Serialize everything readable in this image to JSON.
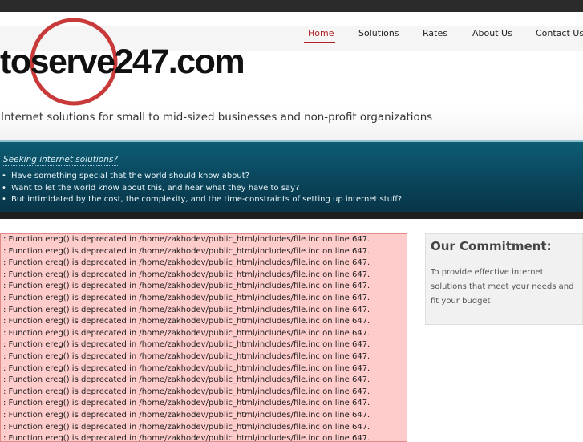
{
  "site": {
    "logo_text": "toserve247.com",
    "tagline": "Internet solutions for small to mid-sized businesses and non-profit organizations"
  },
  "nav": {
    "items": [
      {
        "label": "Home",
        "active": true
      },
      {
        "label": "Solutions",
        "active": false
      },
      {
        "label": "Rates",
        "active": false
      },
      {
        "label": "About Us",
        "active": false
      },
      {
        "label": "Contact Us",
        "active": false
      }
    ]
  },
  "banner": {
    "title": "Seeking internet solutions?",
    "items": [
      "Have something special that the world should know about?",
      "Want to let the world know about this, and hear what they have to say?",
      "But intimidated by the cost, the complexity, and the time-constraints of setting up internet stuff?"
    ]
  },
  "errors": {
    "message": ": Function ereg() is deprecated in /home/zakhodev/public_html/includes/file.inc on line 647.",
    "lines": [
      ": Function ereg() is deprecated in /home/zakhodev/public_html/includes/file.inc on line 647.",
      ": Function ereg() is deprecated in /home/zakhodev/public_html/includes/file.inc on line 647.",
      ": Function ereg() is deprecated in /home/zakhodev/public_html/includes/file.inc on line 647.",
      ": Function ereg() is deprecated in /home/zakhodev/public_html/includes/file.inc on line 647.",
      ": Function ereg() is deprecated in /home/zakhodev/public_html/includes/file.inc on line 647.",
      ": Function ereg() is deprecated in /home/zakhodev/public_html/includes/file.inc on line 647.",
      ": Function ereg() is deprecated in /home/zakhodev/public_html/includes/file.inc on line 647.",
      ": Function ereg() is deprecated in /home/zakhodev/public_html/includes/file.inc on line 647.",
      ": Function ereg() is deprecated in /home/zakhodev/public_html/includes/file.inc on line 647.",
      ": Function ereg() is deprecated in /home/zakhodev/public_html/includes/file.inc on line 647.",
      ": Function ereg() is deprecated in /home/zakhodev/public_html/includes/file.inc on line 647.",
      ": Function ereg() is deprecated in /home/zakhodev/public_html/includes/file.inc on line 647.",
      ": Function ereg() is deprecated in /home/zakhodev/public_html/includes/file.inc on line 647.",
      ": Function ereg() is deprecated in /home/zakhodev/public_html/includes/file.inc on line 647.",
      ": Function ereg() is deprecated in /home/zakhodev/public_html/includes/file.inc on line 647.",
      ": Function ereg() is deprecated in /home/zakhodev/public_html/includes/file.inc on line 647.",
      ": Function ereg() is deprecated in /home/zakhodev/public_html/includes/file.inc on line 647.",
      ": Function ereg() is deprecated in /home/zakhodev/public_html/includes/file.inc on line 647."
    ]
  },
  "sidebar": {
    "title": "Our Commitment:",
    "text": "To provide effective internet solutions that meet your needs and fit your budget"
  },
  "colors": {
    "accent": "#b02222",
    "banner": "#0a4960",
    "error_bg": "#ffcccc"
  }
}
